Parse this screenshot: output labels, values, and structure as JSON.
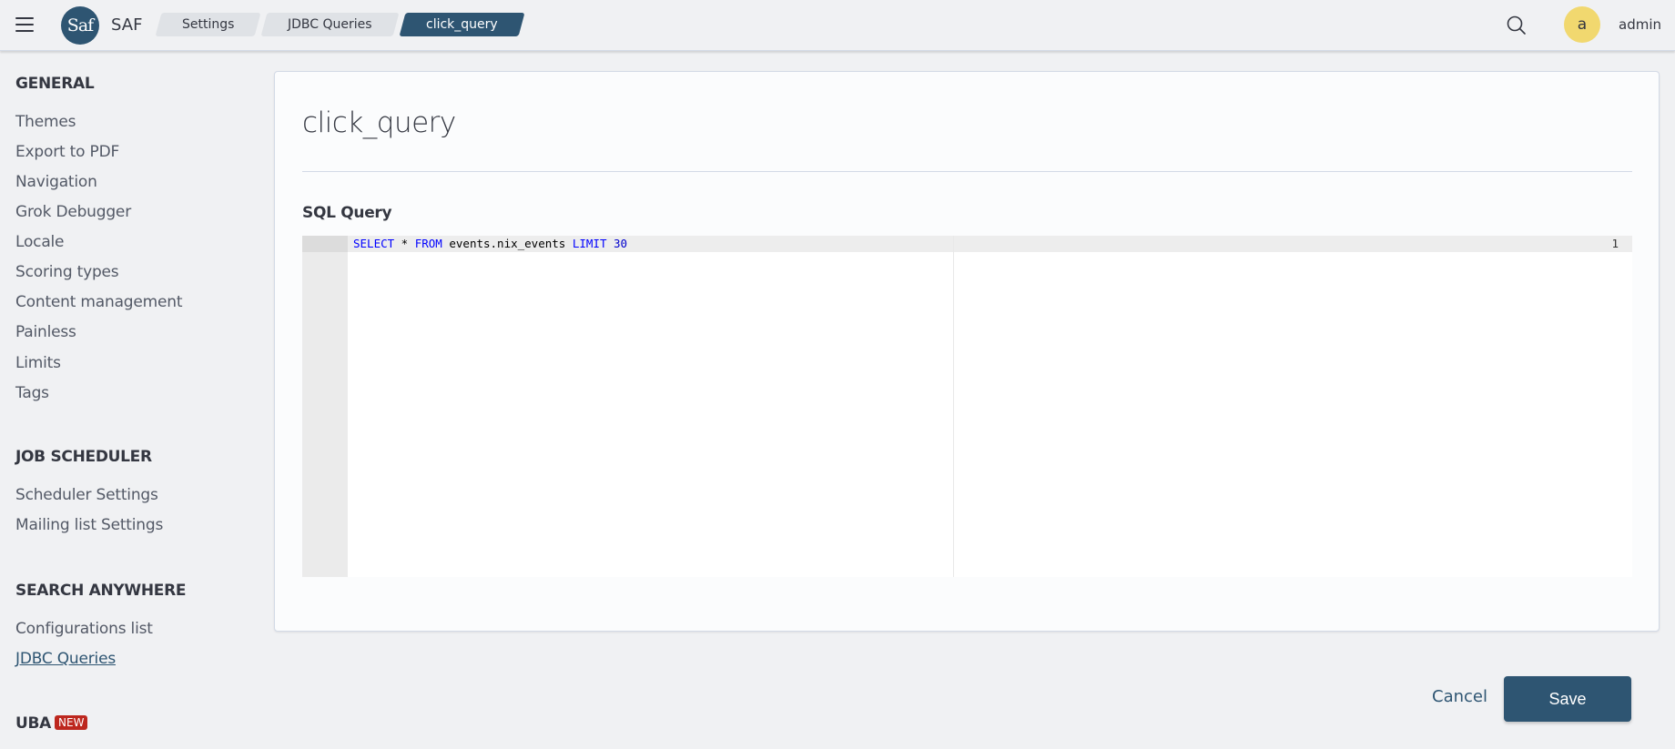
{
  "header": {
    "logo_text": "Saf",
    "app_name": "SAF",
    "breadcrumbs": [
      {
        "label": "Settings"
      },
      {
        "label": "JDBC Queries"
      },
      {
        "label": "click_query"
      }
    ],
    "user": {
      "avatar_letter": "a",
      "name": "admin"
    },
    "icons": {
      "menu": "hamburger-menu-icon",
      "search": "search-icon"
    }
  },
  "sidebar": {
    "sections": [
      {
        "title": "GENERAL",
        "items": [
          "Themes",
          "Export to PDF",
          "Navigation",
          "Grok Debugger",
          "Locale",
          "Scoring types",
          "Content management",
          "Painless",
          "Limits",
          "Tags"
        ]
      },
      {
        "title": "JOB SCHEDULER",
        "items": [
          "Scheduler Settings",
          "Mailing list Settings"
        ]
      },
      {
        "title": "SEARCH ANYWHERE",
        "items": [
          "Configurations list",
          "JDBC Queries"
        ]
      },
      {
        "title": "UBA",
        "badge": "NEW",
        "items": []
      }
    ],
    "current_item": "JDBC Queries"
  },
  "main": {
    "title": "click_query",
    "field_label": "SQL Query",
    "editor": {
      "line_number": "1",
      "tokens": {
        "select": "SELECT",
        "star": " * ",
        "from": "FROM",
        "table": " events.nix_events ",
        "limit": "LIMIT",
        "space": " ",
        "count": "30"
      }
    }
  },
  "actions": {
    "cancel_label": "Cancel",
    "save_label": "Save"
  },
  "colors": {
    "primary": "#2e5572",
    "background": "#f0f1f3",
    "avatar": "#f1d86f",
    "badge": "#bd271e"
  }
}
